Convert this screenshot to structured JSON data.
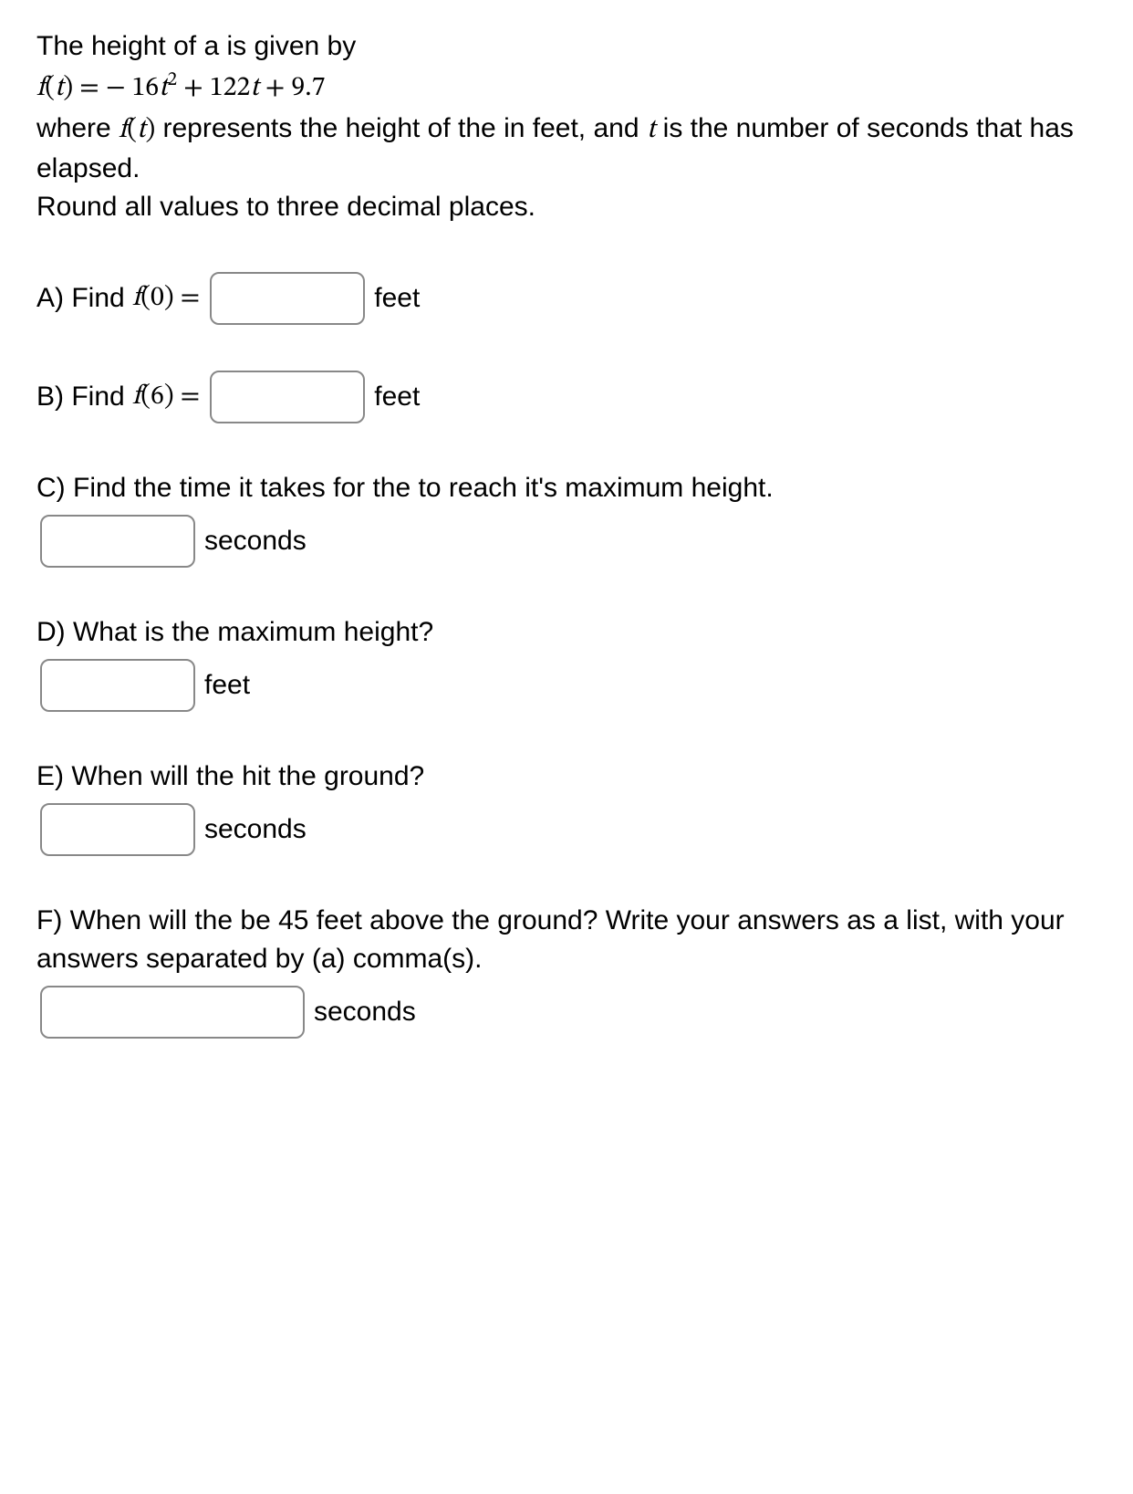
{
  "intro": {
    "line1": "The height of a is given by",
    "formula_prefix": "f",
    "formula_arg": "t",
    "formula_eq": " = ",
    "formula_rhs1": " − 16",
    "formula_rhs_t": "t",
    "formula_rhs_exp": "2",
    "formula_rhs2": " + 122",
    "formula_rhs_t2": "t",
    "formula_rhs3": " + 9.7",
    "line3a": "where ",
    "line3_f": "f",
    "line3_paren1": "(",
    "line3_t": "t",
    "line3_paren2": ")",
    "line3b": " represents the height of the in feet, and ",
    "line3_t2": "t",
    "line3c": " is the number of seconds that has elapsed.",
    "line4": "Round all values to three decimal places."
  },
  "partA": {
    "label_pre": "A) Find ",
    "f": "f",
    "paren1": "(",
    "arg": "0",
    "paren2": ")",
    "eq": " = ",
    "unit": "feet"
  },
  "partB": {
    "label_pre": "B) Find ",
    "f": "f",
    "paren1": "(",
    "arg": "6",
    "paren2": ")",
    "eq": " = ",
    "unit": "feet"
  },
  "partC": {
    "text": "C) Find the time it takes for the to reach it's maximum height.",
    "unit": "seconds"
  },
  "partD": {
    "text": "D) What is the maximum height?",
    "unit": "feet"
  },
  "partE": {
    "text": "E) When will the hit the ground?",
    "unit": "seconds"
  },
  "partF": {
    "text": "F) When will the be 45 feet above the ground? Write your answers as a list, with your answers separated by (a) comma(s).",
    "unit": "seconds"
  }
}
